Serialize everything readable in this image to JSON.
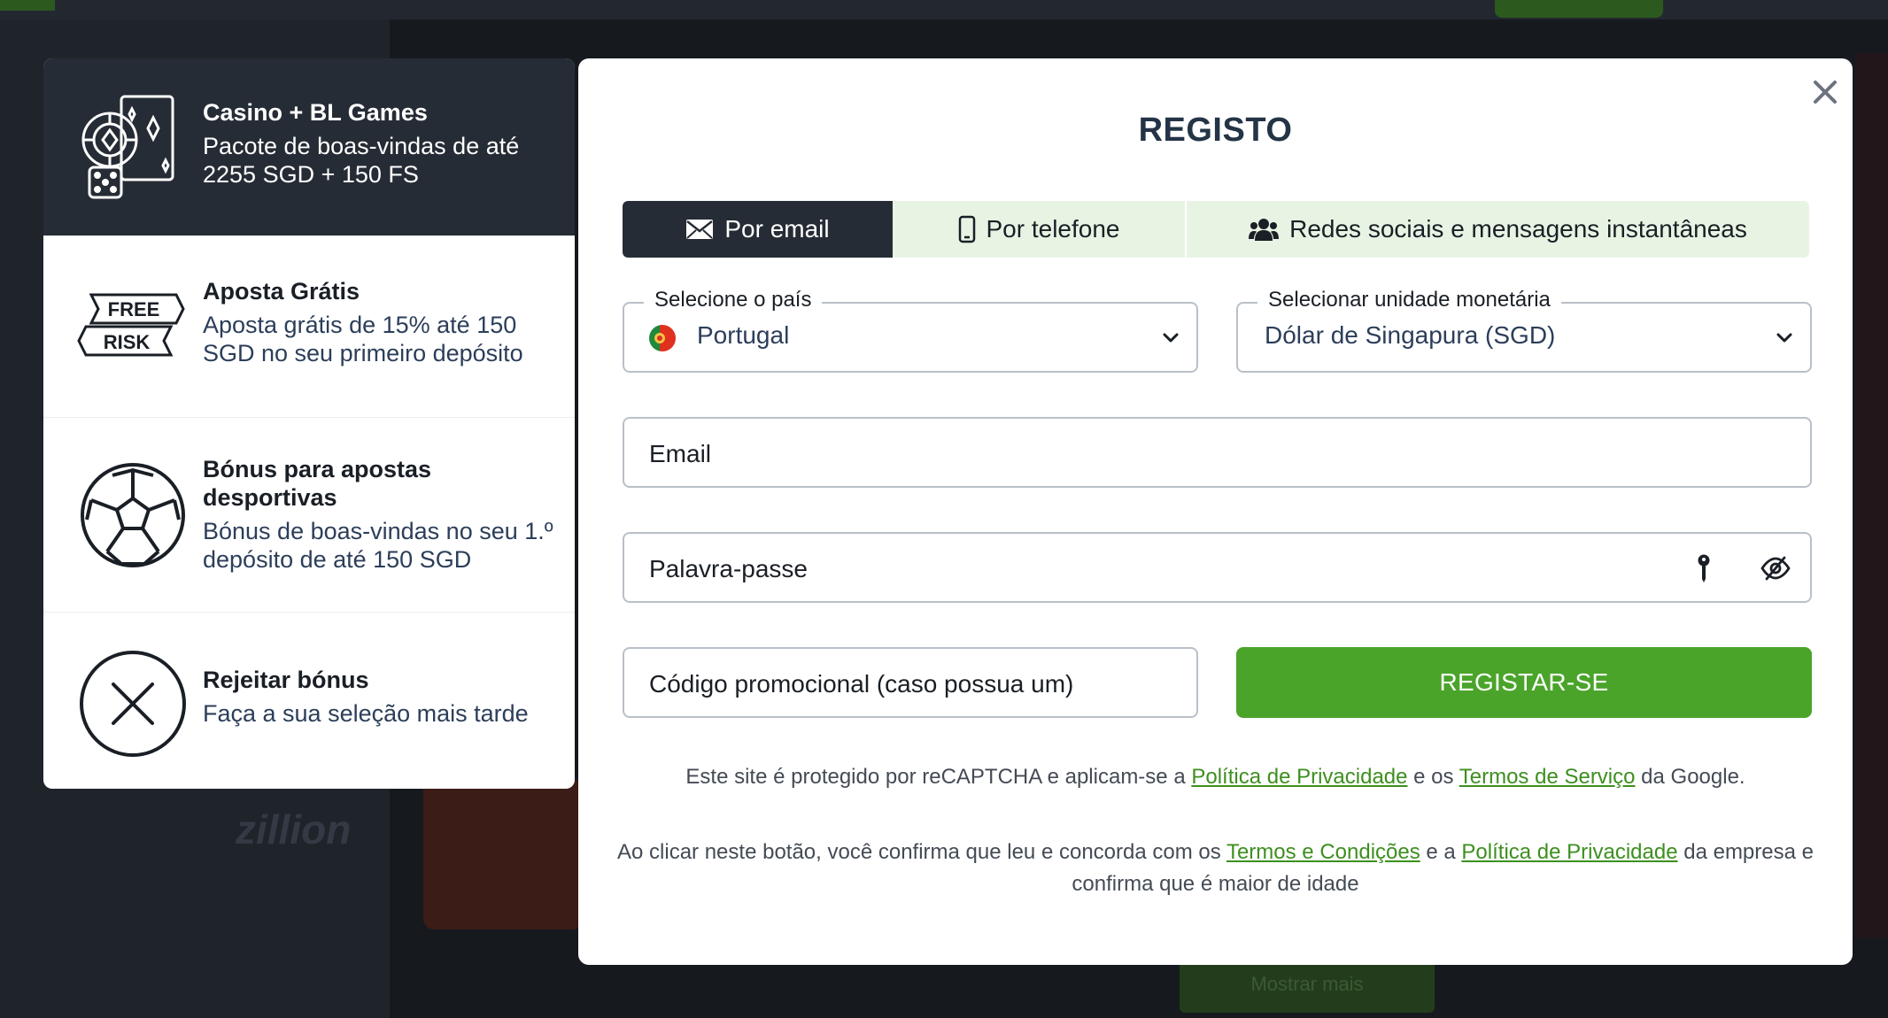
{
  "bonuses": [
    {
      "title": "Casino + BL Games",
      "desc": "Pacote de boas-vindas de até 2255 SGD + 150 FS",
      "icon": "casino-chips-cards-icon",
      "selected": true
    },
    {
      "title": "Aposta Grátis",
      "desc": "Aposta grátis de 15% até 150 SGD no seu primeiro depósito",
      "icon": "free-risk-icon",
      "icon_text_top": "FREE",
      "icon_text_bottom": "RISK"
    },
    {
      "title": "Bónus para apostas desportivas",
      "desc": "Bónus de boas-vindas no seu 1.º depósito de até 150 SGD",
      "icon": "soccer-ball-icon"
    },
    {
      "title": "Rejeitar bónus",
      "desc": "Faça a sua seleção mais tarde",
      "icon": "reject-x-icon"
    }
  ],
  "modal": {
    "title": "REGISTO",
    "close_icon": "close-icon",
    "tabs": [
      {
        "label": "Por email",
        "icon": "envelope-icon",
        "active": true
      },
      {
        "label": "Por telefone",
        "icon": "phone-icon"
      },
      {
        "label": "Redes sociais e mensagens instantâneas",
        "icon": "users-icon"
      }
    ],
    "country": {
      "label": "Selecione o país",
      "value": "Portugal",
      "flag_icon": "portugal-flag-icon"
    },
    "currency": {
      "label": "Selecionar unidade monetária",
      "value": "Dólar de Singapura (SGD)"
    },
    "email": {
      "placeholder": "Email"
    },
    "password": {
      "placeholder": "Palavra-passe",
      "key_icon": "key-icon",
      "eye_icon": "eye-hidden-icon"
    },
    "promo": {
      "placeholder": "Código promocional (caso possua um)"
    },
    "submit_label": "REGISTAR-SE",
    "recaptcha": {
      "pre": "Este site é protegido por reCAPTCHA e aplicam-se a ",
      "link1": "Política de Privacidade",
      "mid": " e os ",
      "link2": "Termos de Serviço",
      "post": " da Google."
    },
    "consent": {
      "pre": "Ao clicar neste botão, você confirma que leu e concorda com os ",
      "link1": "Termos e Condições",
      "mid": " e a ",
      "link2": "Política de Privacidade",
      "post": " da empresa e confirma que é maior de idade"
    }
  },
  "background": {
    "show_more": "Mostrar mais",
    "logos": [
      "zillion"
    ]
  },
  "colors": {
    "accent_green": "#4aa42a",
    "dark": "#262c35",
    "tab_bg": "#e8f4e3",
    "link": "#3d8f1f"
  }
}
